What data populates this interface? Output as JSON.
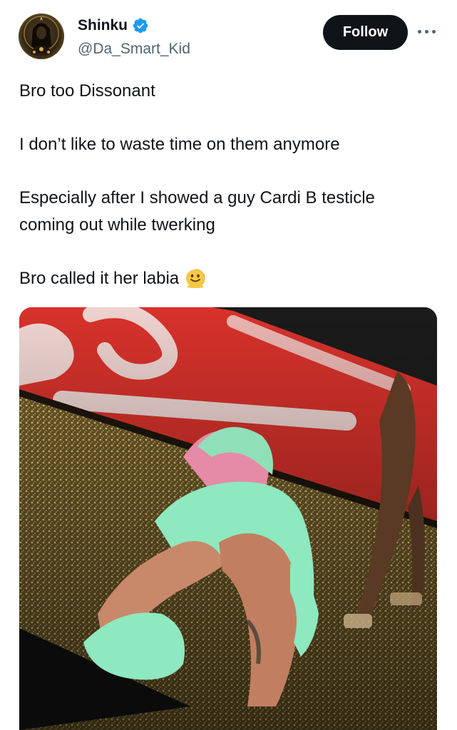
{
  "tweet": {
    "author": {
      "display_name": "Shinku",
      "handle": "@Da_Smart_Kid",
      "verified": true,
      "avatar_icon": "avatar-portrait"
    },
    "follow_label": "Follow",
    "more_icon": "more-horizontal-icon",
    "text_paragraphs": [
      "Bro too Dissonant",
      "I don’t like to waste time on them anymore",
      "Especially after I showed a guy Cardi B testicle coming out while twerking"
    ],
    "last_line": "Bro called it her labia",
    "emoji": "melting-face-emoji",
    "media": {
      "type": "photo"
    }
  },
  "colors": {
    "text_primary": "#0f1419",
    "text_secondary": "#536471",
    "button_bg": "#0f1419",
    "button_text": "#ffffff",
    "verified_blue": "#1d9bf0"
  }
}
